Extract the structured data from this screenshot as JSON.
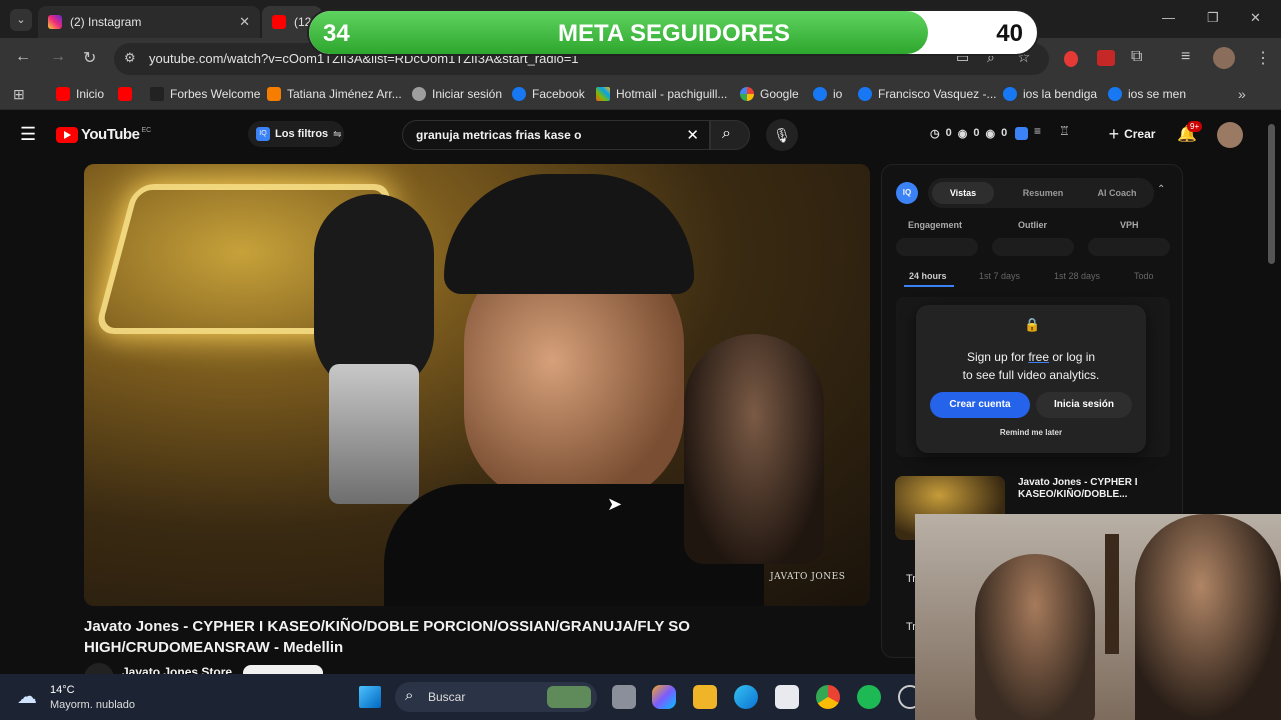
{
  "browser": {
    "tabs": [
      {
        "title": "(2) Instagram",
        "close": "✕"
      },
      {
        "title": "(12"
      }
    ],
    "url": "youtube.com/watch?v=cOom1TZlI3A&list=RDcOom1TZlI3A&start_radio=1",
    "bookmarks": [
      "Inicio",
      "Forbes Welcome",
      "Tatiana Jiménez Arr...",
      "Iniciar sesión",
      "Facebook",
      "Hotmail - pachiguill...",
      "Google",
      "io",
      "Francisco Vasquez -...",
      "ios la bendiga",
      "ios se men"
    ],
    "more_bookmarks": "»"
  },
  "overlay": {
    "left_count": "34",
    "title": "META SEGUIDORES",
    "right_count": "40",
    "progress": 0.85
  },
  "youtube": {
    "logo": "YouTube",
    "region": "EC",
    "filter_label": "Los filtros",
    "search_value": "granuja metricas frias kase o",
    "counters": [
      "0",
      "0",
      "0"
    ],
    "create_label": "Crear",
    "notif_badge": "9+"
  },
  "video": {
    "watermark": "JAVATO JONES",
    "title": "Javato Jones - CYPHER I KASEO/KIÑO/DOBLE PORCION/OSSIAN/GRANUJA/FLY SO HIGH/CRUDOMEANSRAW - Medellin",
    "channel": "Javato Jones Store"
  },
  "panel": {
    "tabs": [
      "Vistas",
      "Resumen",
      "AI Coach"
    ],
    "metrics": [
      "Engagement",
      "Outlier",
      "VPH"
    ],
    "periods": [
      "24 hours",
      "1st 7 days",
      "1st 28 days",
      "Todo"
    ],
    "popup": {
      "line1_pre": "Sign up for ",
      "line1_link": "free",
      "line1_post": " or log in",
      "line2": "to see full video analytics.",
      "primary": "Crear cuenta",
      "secondary": "Inicia sesión",
      "remind": "Remind me later"
    },
    "up_next_title": "Javato Jones - CYPHER I KASEO/KIÑO/DOBLE...",
    "stub1": "Tr",
    "stub2": "Tr"
  },
  "taskbar": {
    "temp": "14°C",
    "weather": "Mayorm. nublado",
    "search_placeholder": "Buscar"
  },
  "colors": {
    "accent_blue": "#3b82f6",
    "yt_red": "#ff0000",
    "overlay_green": "#3fbe3f"
  }
}
